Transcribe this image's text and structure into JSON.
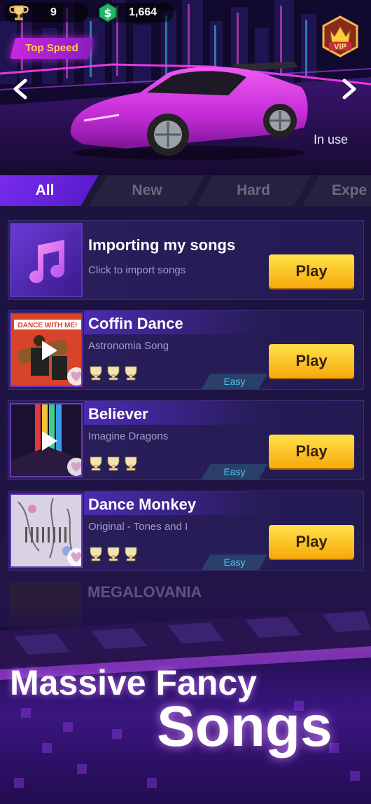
{
  "hud": {
    "trophy_count": "9",
    "cash_amount": "1,664"
  },
  "hero": {
    "badge_label": "Top Speed",
    "vip_label": "VIP",
    "car_status": "In use"
  },
  "tabs": [
    {
      "label": "All",
      "active": true
    },
    {
      "label": "New",
      "active": false
    },
    {
      "label": "Hard",
      "active": false
    },
    {
      "label": "Expe",
      "active": false
    }
  ],
  "songs": [
    {
      "title": "Importing my songs",
      "subtitle": "Click to import songs",
      "play_label": "Play"
    },
    {
      "title": "Coffin Dance",
      "subtitle": "Astronomia Song",
      "play_label": "Play",
      "difficulty": "Easy",
      "trophies": 3
    },
    {
      "title": "Believer",
      "subtitle": "Imagine Dragons",
      "play_label": "Play",
      "difficulty": "Easy",
      "trophies": 3
    },
    {
      "title": "Dance Monkey",
      "subtitle": "Original - Tones and I",
      "play_label": "Play",
      "difficulty": "Easy",
      "trophies": 3
    },
    {
      "title": "MEGALOVANIA"
    }
  ],
  "thumb_text": {
    "coffin_dance": "DANCE WITH ME!"
  },
  "promo": {
    "line1": "Massive Fancy",
    "line2": "Songs"
  },
  "colors": {
    "accent_purple": "#7a2cf0",
    "play_yellow": "#f7a90b",
    "easy_cyan": "#4fc4e8",
    "car_magenta": "#c22bd6"
  }
}
